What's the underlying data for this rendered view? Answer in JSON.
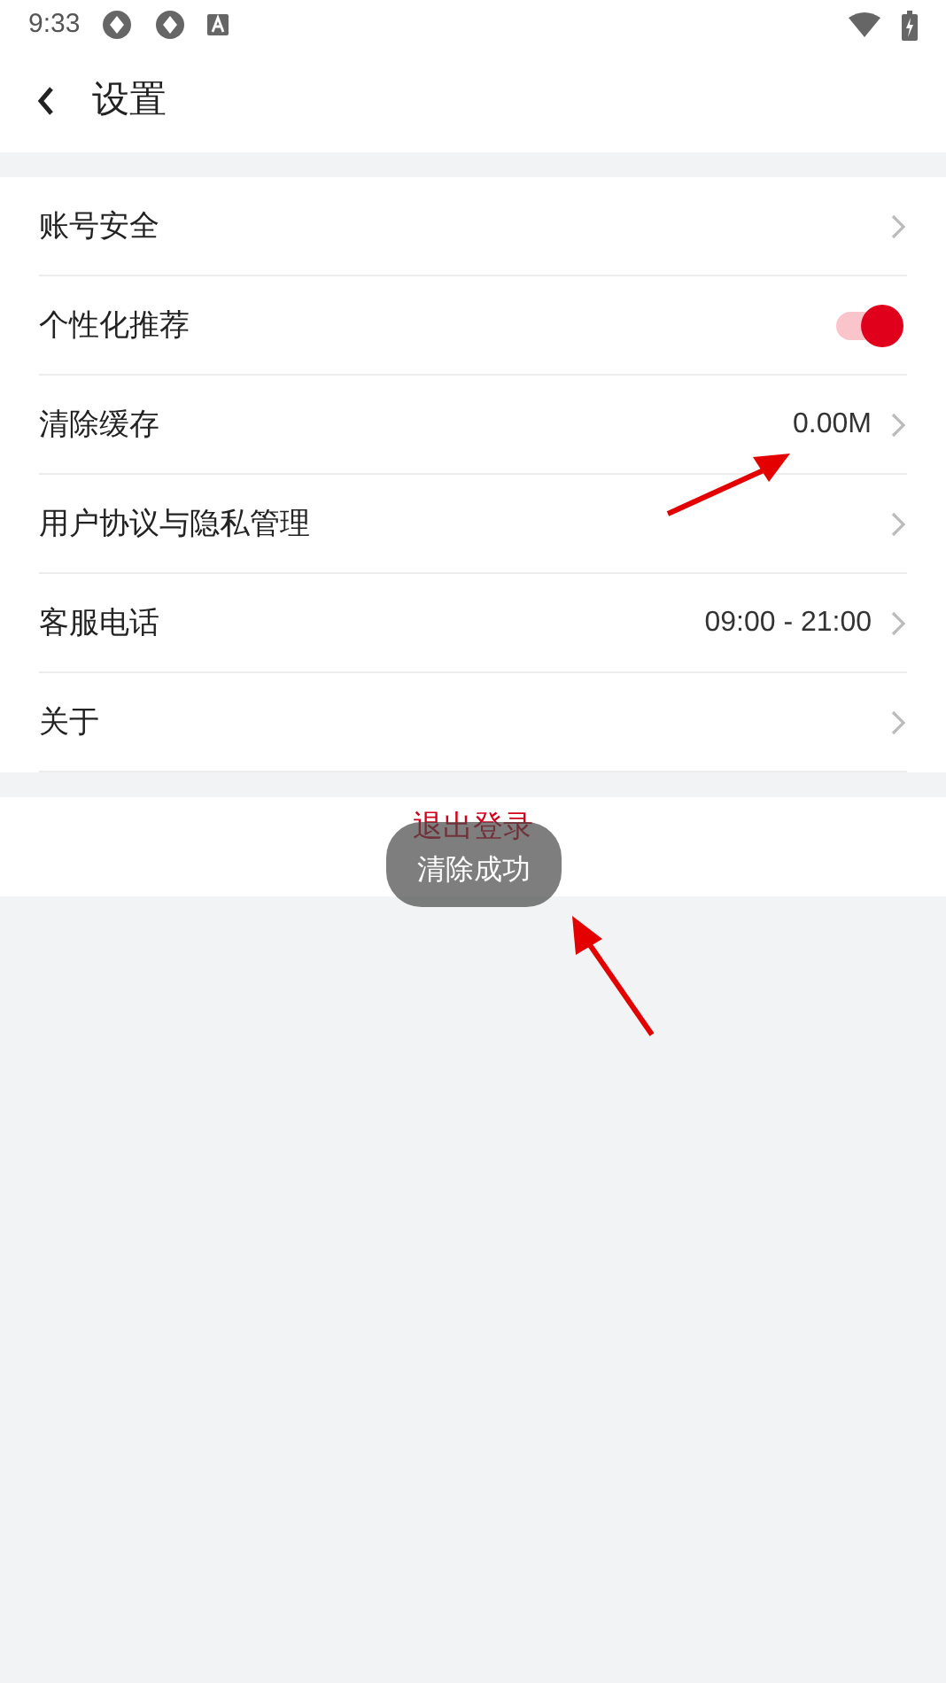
{
  "status_bar": {
    "time": "9:33"
  },
  "header": {
    "title": "设置"
  },
  "settings": [
    {
      "kind": "link",
      "label": "账号安全"
    },
    {
      "kind": "toggle",
      "label": "个性化推荐",
      "on": true
    },
    {
      "kind": "link",
      "label": "清除缓存",
      "value": "0.00M"
    },
    {
      "kind": "link",
      "label": "用户协议与隐私管理"
    },
    {
      "kind": "link",
      "label": "客服电话",
      "value": "09:00 - 21:00"
    },
    {
      "kind": "link",
      "label": "关于"
    }
  ],
  "logout_button": {
    "label": "退出登录"
  },
  "toast": {
    "text": "清除成功"
  }
}
